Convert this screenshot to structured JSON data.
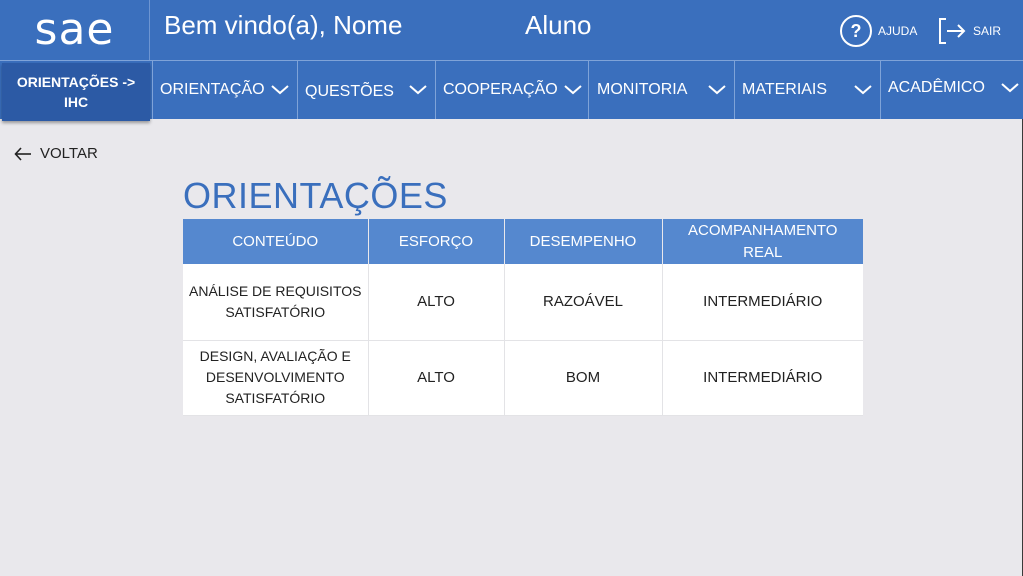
{
  "header": {
    "logo": "sae",
    "welcome": "Bem vindo(a), Nome",
    "role": "Aluno",
    "help_label": "AJUDA",
    "logout_label": "SAIR"
  },
  "nav": {
    "active_line1": "ORIENTAÇÕES ->",
    "active_line2": "IHC",
    "items": [
      {
        "label": "ORIENTAÇÃO"
      },
      {
        "label": "QUESTÕES"
      },
      {
        "label": "COOPERAÇÃO"
      },
      {
        "label": "MONITORIA"
      },
      {
        "label": "MATERIAIS"
      },
      {
        "label": "ACADÊMICO"
      }
    ]
  },
  "back_label": "VOLTAR",
  "page_title": "ORIENTAÇÕES",
  "table": {
    "headers": [
      "CONTEÚDO",
      "ESFORÇO",
      "DESEMPENHO",
      "ACOMPANHAMENTO REAL"
    ],
    "header_lines": {
      "h4_line1": "ACOMPANHAMENTO",
      "h4_line2": "REAL"
    },
    "rows": [
      {
        "content_lines": [
          "ANÁLISE DE REQUISITOS",
          "SATISFATÓRIO"
        ],
        "esforco": "ALTO",
        "desempenho": "RAZOÁVEL",
        "acompanhamento": "INTERMEDIÁRIO"
      },
      {
        "content_lines": [
          "DESIGN, AVALIAÇÃO E",
          "DESENVOLVIMENTO",
          "SATISFATÓRIO"
        ],
        "esforco": "ALTO",
        "desempenho": "BOM",
        "acompanhamento": "INTERMEDIÁRIO"
      }
    ]
  },
  "colors": {
    "brand": "#3a6fbd",
    "header_cell": "#5588cf",
    "background": "#e9e8ec"
  },
  "icons": [
    "help-icon",
    "logout-icon",
    "chevron-down-icon",
    "arrow-left-icon"
  ]
}
